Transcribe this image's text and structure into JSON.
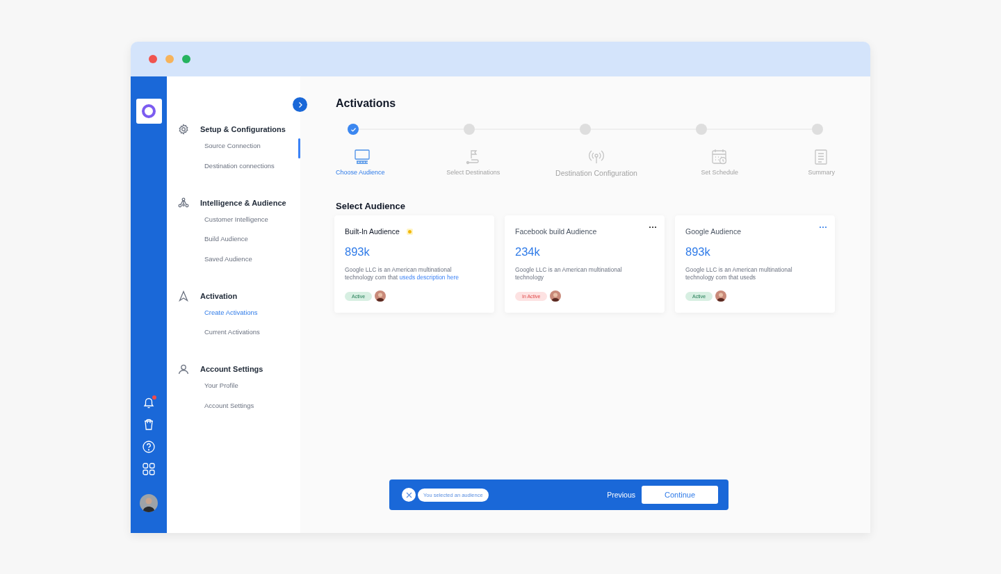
{
  "nav": {
    "sections": [
      {
        "title": "Setup & Configurations",
        "items": [
          {
            "label": "Source Connection",
            "selected": false
          },
          {
            "label": "Destination connections",
            "selected": false
          }
        ]
      },
      {
        "title": "Intelligence & Audience",
        "items": [
          {
            "label": "Customer Intelligence",
            "selected": false
          },
          {
            "label": "Build Audience",
            "selected": false
          },
          {
            "label": "Saved Audience",
            "selected": false
          }
        ]
      },
      {
        "title": "Activation",
        "items": [
          {
            "label": "Create Activations",
            "selected": true
          },
          {
            "label": "Current Activations",
            "selected": false
          }
        ]
      },
      {
        "title": "Account Settings",
        "items": [
          {
            "label": "Your Profile",
            "selected": false
          },
          {
            "label": "Account Settings",
            "selected": false
          }
        ]
      }
    ]
  },
  "page": {
    "title": "Activations"
  },
  "steps": [
    {
      "label": "Choose Audience",
      "done": true
    },
    {
      "label": "Select Destinations",
      "done": false
    },
    {
      "label": "Destination Configuration",
      "done": false
    },
    {
      "label": "Set Schedule",
      "done": false
    },
    {
      "label": "Summary",
      "done": false
    }
  ],
  "section_title": "Select Audience",
  "cards": [
    {
      "title": "Built-In Audience",
      "title_strong": true,
      "flag": true,
      "menu": false,
      "count": "893k",
      "description": "Google LLC is an American multinational technology com that",
      "link": "useds description here",
      "status": {
        "kind": "active",
        "label": "Active"
      }
    },
    {
      "title": "Facebook build Audience",
      "title_strong": false,
      "flag": false,
      "menu": true,
      "menu_highlighted": false,
      "count": "234k",
      "description": "Google LLC is an American multinational technology",
      "status": {
        "kind": "inactive",
        "label": "In Active"
      }
    },
    {
      "title": "Google Audience",
      "title_strong": false,
      "flag": false,
      "menu": true,
      "menu_highlighted": true,
      "count": "893k",
      "description": "Google LLC is an American multinational technology com that useds",
      "status": {
        "kind": "active",
        "label": "Active"
      }
    }
  ],
  "action_bar": {
    "message": "You selected an audience",
    "previous": "Previous",
    "continue": "Continue"
  },
  "notifications": {
    "unread": true
  }
}
